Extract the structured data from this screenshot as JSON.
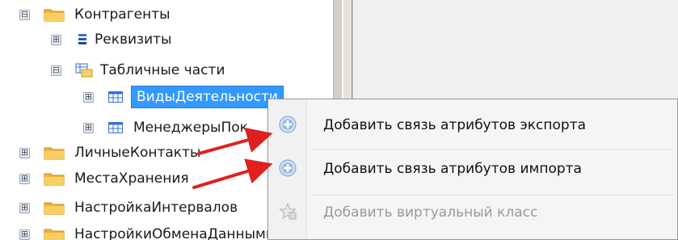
{
  "tree": {
    "items": [
      {
        "label": "Контрагенты",
        "expander": "⊟",
        "icon": "folder-icon"
      },
      {
        "label": "Реквизиты",
        "expander": "⊞",
        "icon": "requisites-icon"
      },
      {
        "label": "Табличные части",
        "expander": "⊟",
        "icon": "tabular-parts-icon"
      },
      {
        "label": "ВидыДеятельности",
        "expander": "⊞",
        "icon": "table-icon",
        "selected": true
      },
      {
        "label": "МенеджерыПок",
        "expander": "⊞",
        "icon": "table-icon"
      },
      {
        "label": "ЛичныеКонтакты",
        "expander": "⊞",
        "icon": "folder-icon"
      },
      {
        "label": "МестаХранения",
        "expander": "⊞",
        "icon": "folder-icon"
      },
      {
        "label": "НастройкаИнтервалов",
        "expander": "⊞",
        "icon": "folder-icon"
      },
      {
        "label": "НастройкиОбменаДанными",
        "expander": "⊞",
        "icon": "folder-icon"
      }
    ]
  },
  "context_menu": {
    "items": [
      {
        "label": "Добавить связь атрибутов экспорта",
        "icon": "add-icon",
        "enabled": true
      },
      {
        "label": "Добавить связь атрибутов импорта",
        "icon": "add-icon",
        "enabled": true
      },
      {
        "label": "Добавить виртуальный класс",
        "icon": "virtual-class-icon",
        "enabled": false
      }
    ]
  },
  "colors": {
    "selection": "#3399ff",
    "annotation_arrow": "#e02020",
    "folder": "#f0b43a"
  }
}
